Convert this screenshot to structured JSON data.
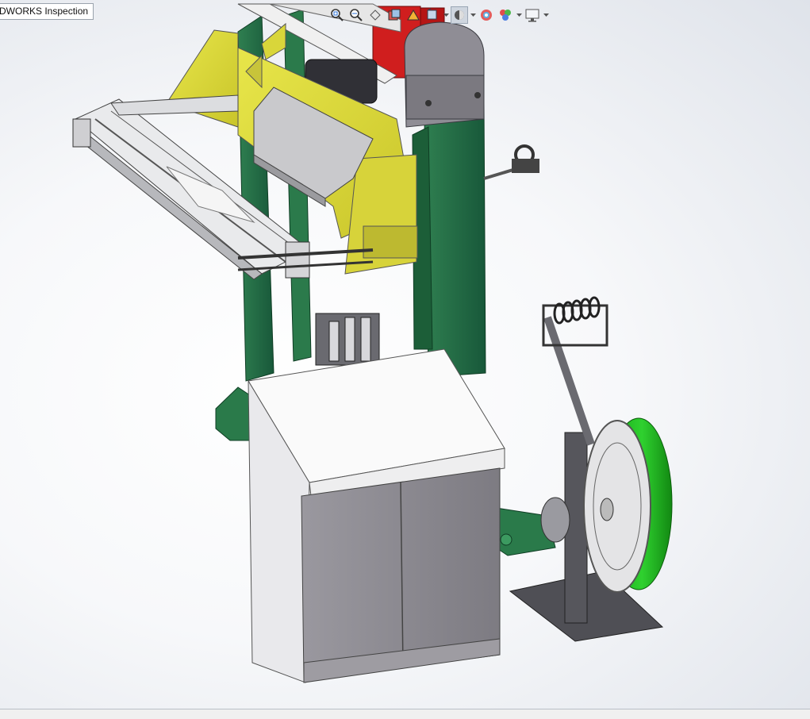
{
  "app": {
    "tab_label": "DWORKS Inspection"
  },
  "heads_up_toolbar": {
    "items": [
      {
        "name": "zoom-to-fit",
        "icon": "zoom-to-fit-icon"
      },
      {
        "name": "zoom-to-area",
        "icon": "zoom-to-area-icon"
      },
      {
        "name": "previous-view",
        "icon": "previous-view-icon"
      },
      {
        "name": "section-view",
        "icon": "section-view-icon"
      },
      {
        "name": "dynamic-annotation-views",
        "icon": "dynamic-annotation-icon"
      },
      {
        "name": "view-orientation",
        "icon": "view-orientation-icon"
      },
      {
        "name": "display-style",
        "icon": "display-style-icon"
      },
      {
        "name": "hide-show-items",
        "icon": "hide-show-icon"
      },
      {
        "name": "edit-appearance",
        "icon": "edit-appearance-icon"
      },
      {
        "name": "apply-scene",
        "icon": "apply-scene-icon"
      },
      {
        "name": "view-settings",
        "icon": "view-settings-icon"
      }
    ]
  },
  "colors": {
    "frame_green": "#1f6b3f",
    "bracket_yellow": "#d9d63a",
    "motor_red": "#d01e1e",
    "reel_green": "#22b322",
    "cabinet_gray": "#8c8a90"
  }
}
